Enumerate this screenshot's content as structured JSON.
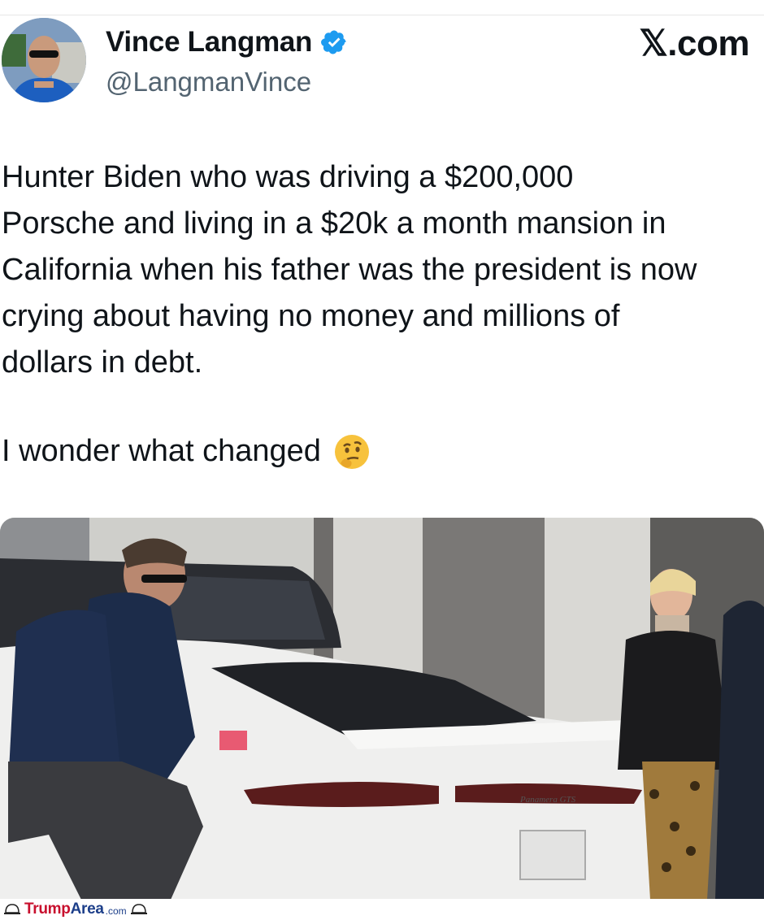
{
  "header": {
    "name": "Vince Langman",
    "handle": "@LangmanVince",
    "brand": "𝕏.com"
  },
  "tweet": {
    "lines": [
      "Hunter Biden who was driving a $200,000",
      "Porsche and living in a $20k a month mansion in",
      "California when his father was the president is now",
      "crying about having no money and millions of",
      "dollars in debt."
    ],
    "second": "I wonder what changed",
    "emoji": "thinking-face"
  },
  "photo": {
    "car_badge": "Panamera GTS"
  },
  "watermark": {
    "part1": "Trump",
    "part2": "Area",
    "domain": ".com"
  },
  "colors": {
    "verified": "#1d9bf0",
    "watermark_red": "#c8102e",
    "watermark_blue": "#1d3f8a"
  }
}
